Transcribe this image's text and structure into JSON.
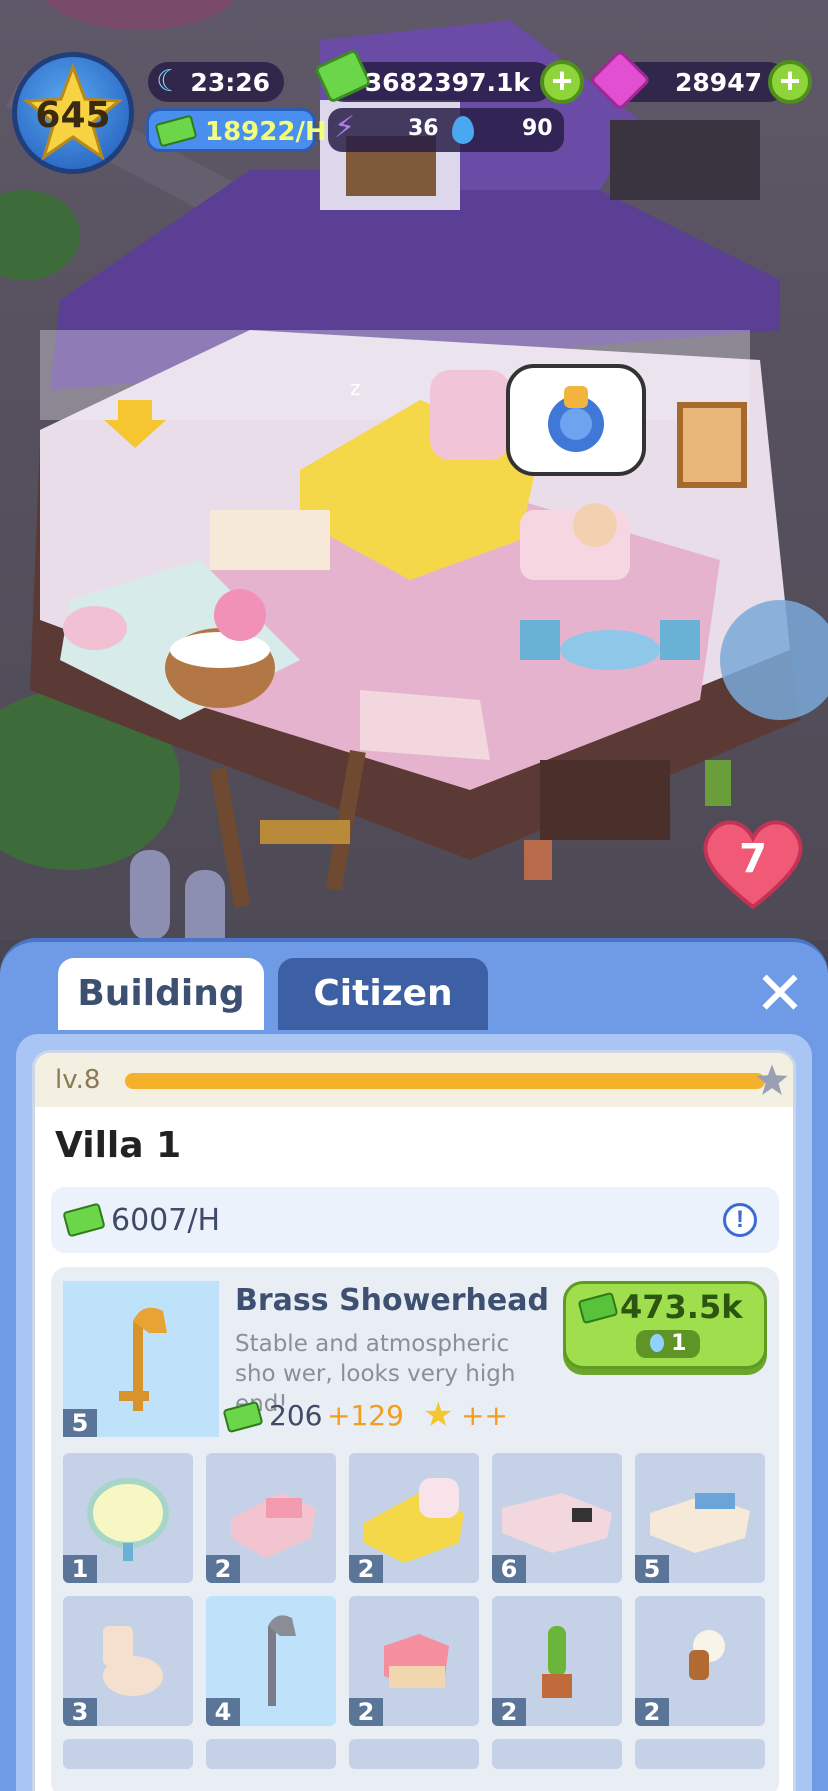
{
  "hud": {
    "player_level": "645",
    "time": "23:26",
    "cash": "3682397.1k",
    "gems": "28947",
    "income_rate": "18922/H",
    "energy": "36",
    "water": "90"
  },
  "scene": {
    "heart_count": "7"
  },
  "panel": {
    "tabs": [
      "Building",
      "Citizen"
    ],
    "active_tab": "Building",
    "close_symbol": "✕",
    "building": {
      "level_label": "lv.8",
      "level_progress": 1.0,
      "name": "Villa 1",
      "income": "6007/H",
      "info_symbol": "!",
      "featured": {
        "name": "Brass Showerhead",
        "description": "Stable and atmospheric sho wer, looks very high end!",
        "income_base": "206",
        "income_bonus": "+129",
        "star_bonus": "++",
        "count": "5",
        "price": "473.5k",
        "water_cost": "1"
      },
      "items": [
        {
          "name": "round-mirror",
          "count": "1"
        },
        {
          "name": "pink-bed",
          "count": "2"
        },
        {
          "name": "double-bed",
          "count": "2"
        },
        {
          "name": "kitchen-counter",
          "count": "6"
        },
        {
          "name": "study-desk",
          "count": "5"
        },
        {
          "name": "toilet",
          "count": "3"
        },
        {
          "name": "showerhead",
          "count": "4"
        },
        {
          "name": "nightstand",
          "count": "2"
        },
        {
          "name": "cactus-pot",
          "count": "2"
        },
        {
          "name": "wall-lamp",
          "count": "2"
        }
      ]
    }
  },
  "colors": {
    "panel_bg": "#6f9ae6",
    "buy_green": "#9fdf4e",
    "level_bar": "#f6b12a",
    "income_accent": "#f2ff7a"
  }
}
